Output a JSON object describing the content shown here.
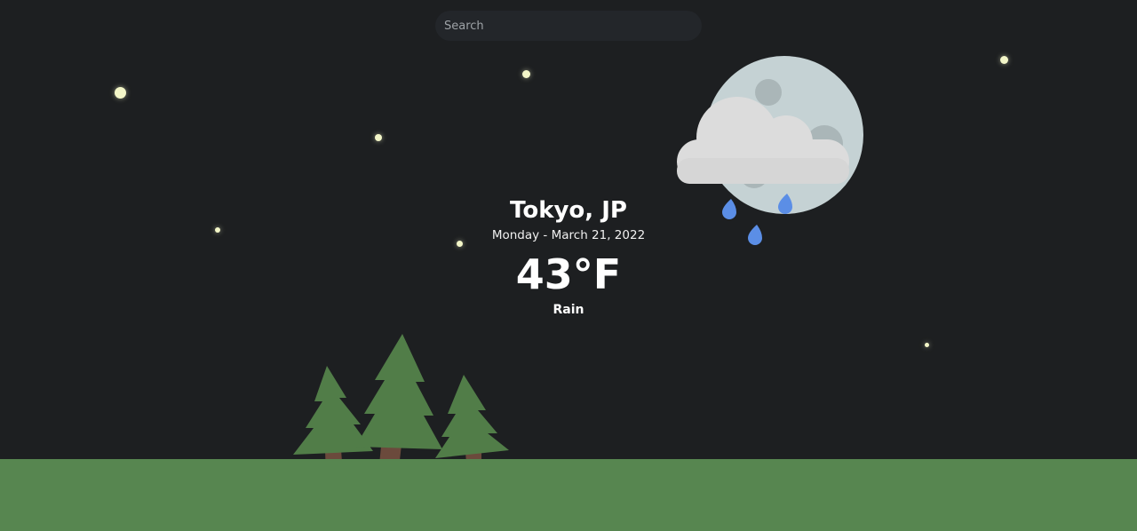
{
  "search": {
    "placeholder": "Search",
    "value": ""
  },
  "location": {
    "city": "Tokyo, JP"
  },
  "date": "Monday - March 21, 2022",
  "temperature": "43°F",
  "condition": "Rain",
  "icons": {
    "weather": "moon-cloud-rain-icon",
    "scenery": "pine-trees"
  },
  "colors": {
    "background": "#1d1f21",
    "ground": "#578650",
    "tree": "#517d48",
    "trunk": "#6b4a3c",
    "moon": "#c5d2d4",
    "cloud": "#dcdcdc",
    "raindrop": "#5b8ee6",
    "star": "#f3f6c8",
    "text": "#ffffff"
  }
}
